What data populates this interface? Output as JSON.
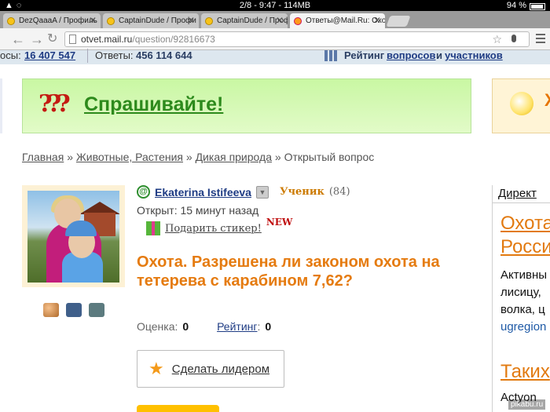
{
  "statusbar": {
    "time_info": "2/8 - 9:47 - 114MB",
    "battery": "94 %"
  },
  "tabs": [
    {
      "label": "DezQaaaA / Профиль"
    },
    {
      "label": "CaptainDude / Профи"
    },
    {
      "label": "CaptainDude / Профи"
    },
    {
      "label": "Ответы@Mail.Ru: Охо"
    }
  ],
  "address": {
    "host": "otvet.mail.ru",
    "path": "/question/92816673"
  },
  "stats": {
    "questions_label": "осы:",
    "questions_value": "16 407 547",
    "answers_label": "Ответы:",
    "answers_value": "456 114 644",
    "rating_label": "Рейтинг",
    "rating_link1": "вопросов",
    "rating_and": "и",
    "rating_link2": "участников"
  },
  "banner": {
    "marks": "???",
    "text": "Спрашивайте!",
    "right_partial": "Х"
  },
  "breadcrumb": {
    "home": "Главная",
    "sep": "»",
    "cat": "Животные, Растения",
    "sub": "Дикая природа",
    "current": "Открытый вопрос"
  },
  "author": {
    "name": "Ekaterina Istifeeva",
    "rank": "Ученик",
    "points": "(84)"
  },
  "opened": "Открыт: 15 минут назад",
  "gift": {
    "label": "Подарить стикер!",
    "badge": "NEW"
  },
  "question": {
    "title": "Охота. Разрешена ли законом охота на тетерева с карабином 7,62?"
  },
  "rating": {
    "score_label": "Оценка:",
    "score_value": "0",
    "rating_label": "Рейтинг",
    "rating_value": "0"
  },
  "leader_button": {
    "label": "Сделать лидером"
  },
  "direct": {
    "header": "Директ",
    "ad1_title_l1": "Охота",
    "ad1_title_l2": "Росси",
    "ad1_text_l1": "Активны",
    "ad1_text_l2": "лисицу,",
    "ad1_text_l3": "волка, ц",
    "ad1_url": "ugregion",
    "ad2_title": "Таких",
    "ad2_text": "Actyon"
  },
  "watermark": "pikabu.ru"
}
